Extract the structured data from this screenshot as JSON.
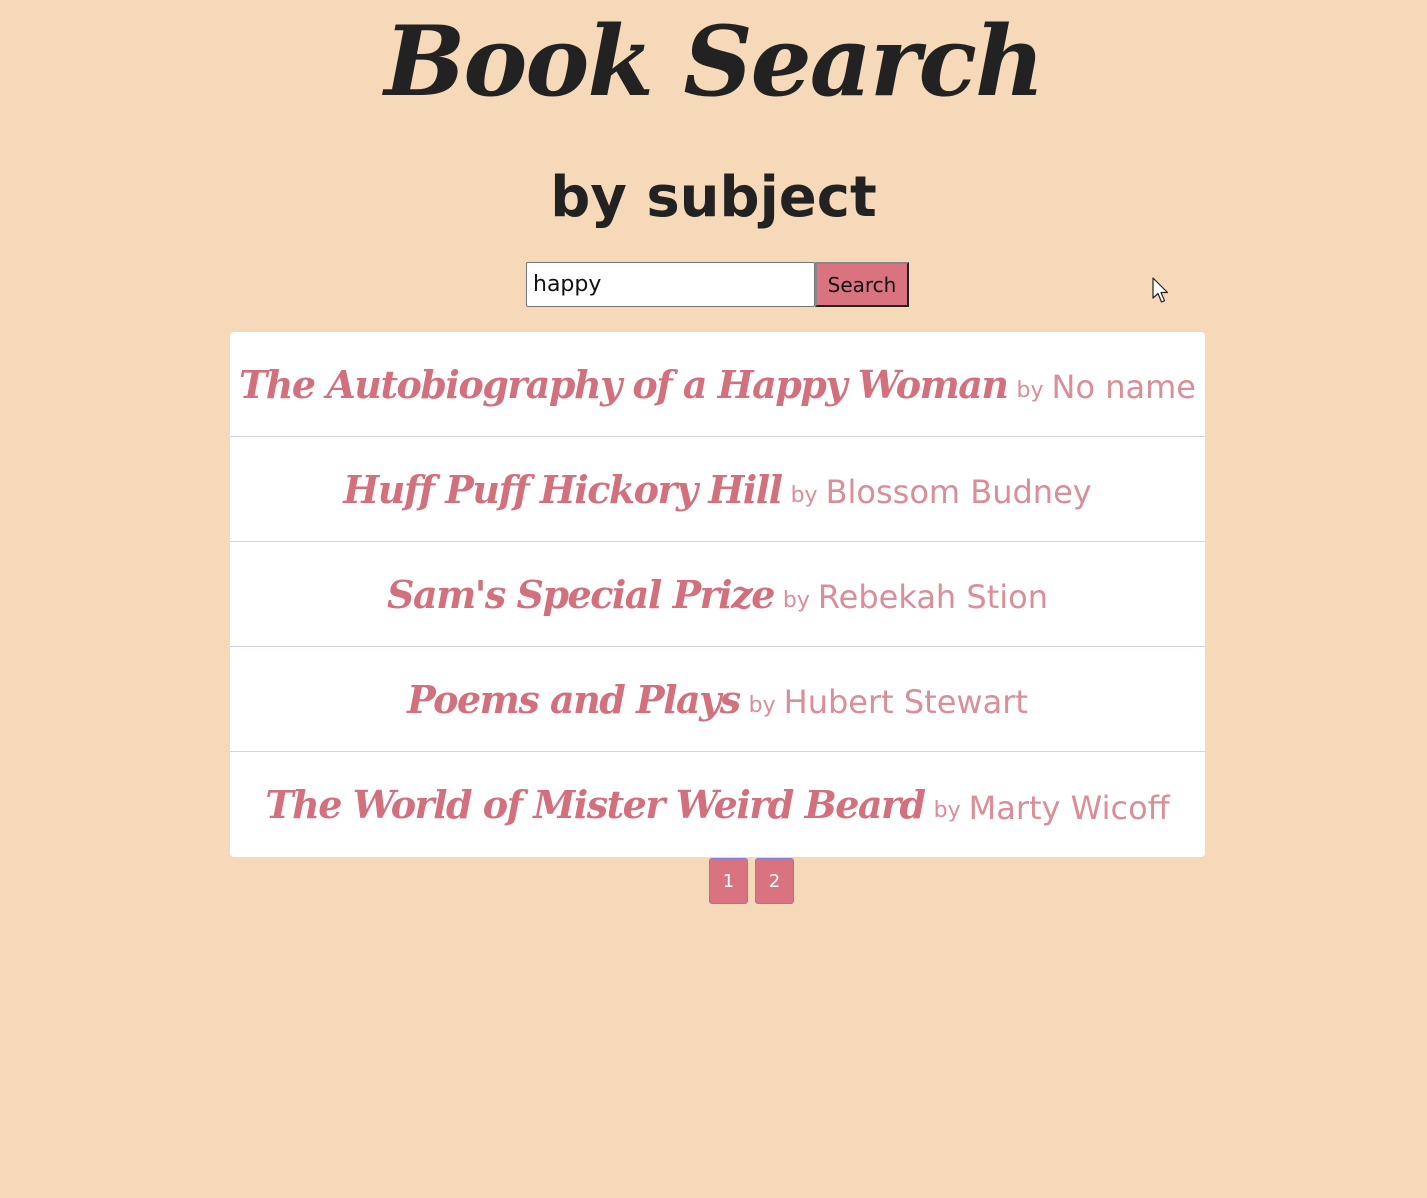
{
  "header": {
    "title": "Book Search",
    "subtitle": "by subject"
  },
  "search": {
    "value": "happy",
    "button_label": "Search"
  },
  "results": [
    {
      "title": "The Autobiography of a Happy Woman",
      "by": "by",
      "author": "No name"
    },
    {
      "title": "Huff Puff Hickory Hill",
      "by": "by",
      "author": "Blossom Budney"
    },
    {
      "title": "Sam's Special Prize",
      "by": "by",
      "author": "Rebekah Stion"
    },
    {
      "title": "Poems and Plays",
      "by": "by",
      "author": "Hubert Stewart"
    },
    {
      "title": "The World of Mister Weird Beard",
      "by": "by",
      "author": "Marty Wicoff"
    }
  ],
  "pagination": {
    "pages": [
      "1",
      "2"
    ]
  },
  "colors": {
    "background": "#f5d9b9",
    "accent": "#d9737f",
    "title_text": "#d3707e",
    "author_text": "#d98e98"
  },
  "icons": {
    "cursor": "mouse-pointer-icon"
  }
}
